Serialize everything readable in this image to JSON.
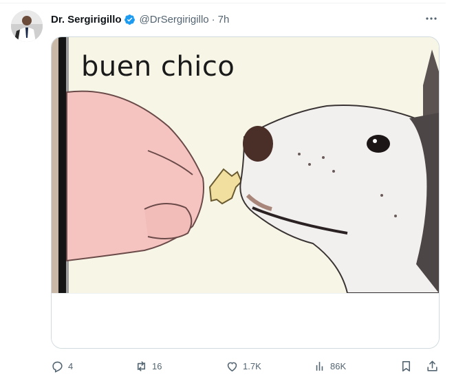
{
  "tweet": {
    "author": {
      "display_name": "Dr. Sergirigillo",
      "handle": "@DrSergirigillo",
      "verified": true
    },
    "separator": "·",
    "time": "7h",
    "media": {
      "caption": "buen chico"
    },
    "actions": {
      "replies": "4",
      "retweets": "16",
      "likes": "1.7K",
      "views": "86K"
    }
  },
  "colors": {
    "verified_badge": "#1d9bf0",
    "secondary_text": "#536471",
    "meme_background": "#f7f6e6"
  },
  "icons": [
    "verified-icon",
    "more-icon",
    "reply-icon",
    "retweet-icon",
    "like-icon",
    "views-icon",
    "bookmark-icon",
    "share-icon"
  ]
}
